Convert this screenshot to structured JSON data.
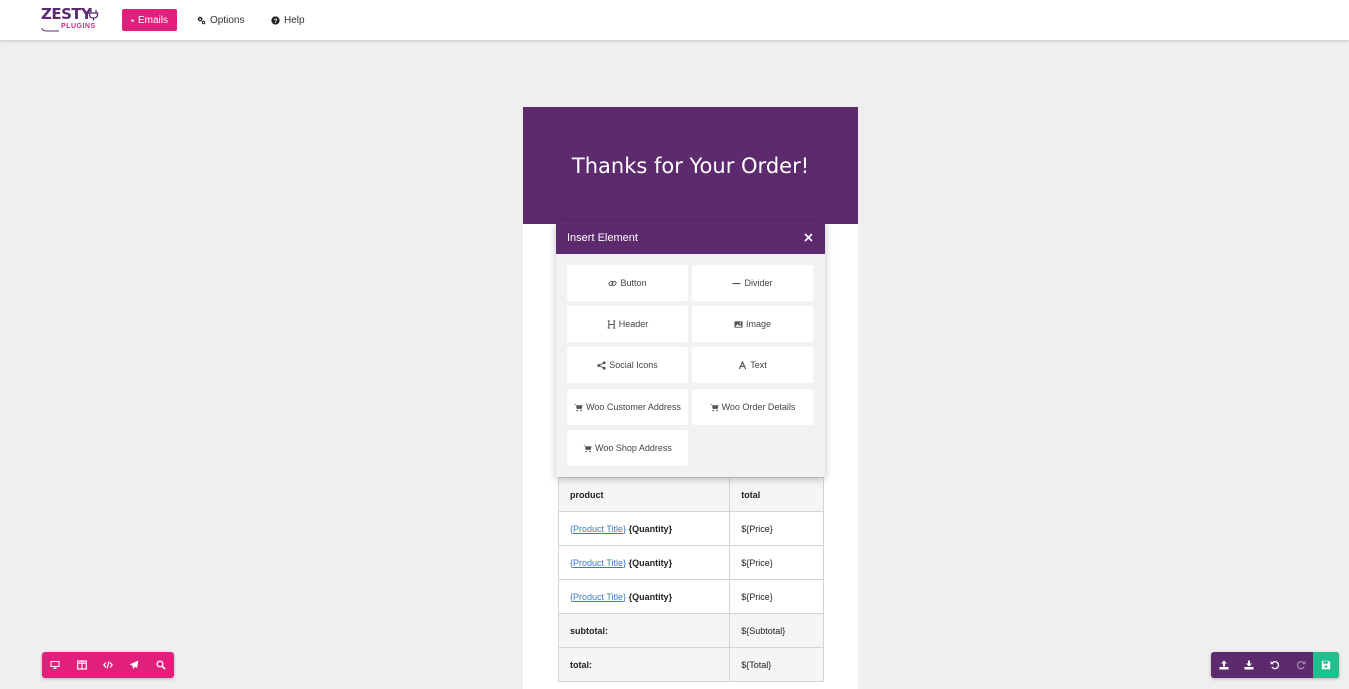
{
  "brand": {
    "logo_top": "ZESTY",
    "logo_bottom": "PLUGINS",
    "primary": "#e0207a",
    "secondary": "#5d2a6d",
    "save_color": "#1fc08e"
  },
  "nav": {
    "emails": {
      "label": "Emails",
      "icon": "envelope-icon",
      "active": true
    },
    "options": {
      "label": "Options",
      "icon": "cogs-icon"
    },
    "help": {
      "label": "Help",
      "icon": "question-circle-icon"
    }
  },
  "email": {
    "heading": "Thanks for Your Order!",
    "table": {
      "headers": [
        "product",
        "total"
      ],
      "rows": [
        {
          "title": "{Product Title}",
          "qty": "{Quantity}",
          "price": "${Price}"
        },
        {
          "title": "{Product Title}",
          "qty": "{Quantity}",
          "price": "${Price}"
        },
        {
          "title": "{Product Title}",
          "qty": "{Quantity}",
          "price": "${Price}"
        }
      ],
      "subtotal": {
        "label": "subtotal:",
        "value": "${Subtotal}"
      },
      "total": {
        "label": "total:",
        "value": "${Total}"
      }
    }
  },
  "modal": {
    "title": "Insert Element",
    "close_icon": "close-icon",
    "items": [
      {
        "label": "Button",
        "icon": "link-icon"
      },
      {
        "label": "Divider",
        "icon": "minus-icon"
      },
      {
        "label": "Header",
        "icon": "heading-icon"
      },
      {
        "label": "Image",
        "icon": "image-icon"
      },
      {
        "label": "Social Icons",
        "icon": "share-icon"
      },
      {
        "label": "Text",
        "icon": "font-icon"
      },
      {
        "label": "Woo Customer Address",
        "icon": "cart-icon"
      },
      {
        "label": "Woo Order Details",
        "icon": "cart-icon"
      },
      {
        "label": "Woo Shop Address",
        "icon": "cart-icon"
      }
    ]
  },
  "toolbar_left": [
    "desktop-icon",
    "columns-icon",
    "code-icon",
    "send-icon",
    "search-icon"
  ],
  "toolbar_right": [
    "upload-icon",
    "download-icon",
    "undo-icon",
    "redo-icon",
    "save-icon"
  ]
}
